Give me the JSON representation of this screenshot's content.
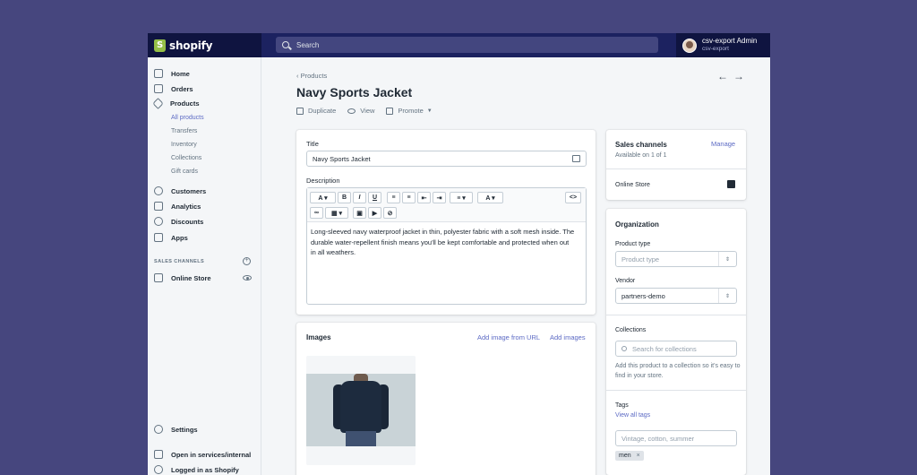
{
  "topbar": {
    "brand": "shopify",
    "search_placeholder": "Search",
    "user_name": "csv-export Admin",
    "user_store": "csv-export"
  },
  "sidebar": {
    "items": [
      {
        "label": "Home",
        "icon": "home-icon"
      },
      {
        "label": "Orders",
        "icon": "orders-icon"
      },
      {
        "label": "Products",
        "icon": "tag-icon"
      },
      {
        "label": "Customers",
        "icon": "customer-icon"
      },
      {
        "label": "Analytics",
        "icon": "analytics-icon"
      },
      {
        "label": "Discounts",
        "icon": "discount-icon"
      },
      {
        "label": "Apps",
        "icon": "apps-icon"
      }
    ],
    "sub_items": [
      "All products",
      "Transfers",
      "Inventory",
      "Collections",
      "Gift cards"
    ],
    "sales_channels_label": "SALES CHANNELS",
    "online_store": "Online Store",
    "settings": "Settings",
    "open_in_services": "Open in services/internal",
    "logged_in": "Logged in as Shopify"
  },
  "main": {
    "breadcrumb": "Products",
    "title": "Navy Sports Jacket",
    "actions": [
      "Duplicate",
      "View",
      "Promote"
    ]
  },
  "product_card": {
    "title_label": "Title",
    "title_value": "Navy Sports Jacket",
    "description_label": "Description",
    "description_text": "Long-sleeved navy waterproof jacket in thin, polyester fabric with a soft mesh inside. The durable water-repellent finish means you'll be kept comfortable and protected when out in all weathers."
  },
  "images_card": {
    "title": "Images",
    "add_from_url": "Add image from URL",
    "add_images": "Add images"
  },
  "sales_channels_card": {
    "title": "Sales channels",
    "subtitle": "Available on 1 of 1",
    "manage": "Manage",
    "channel": "Online Store"
  },
  "organization_card": {
    "title": "Organization",
    "product_type_label": "Product type",
    "product_type_placeholder": "Product type",
    "vendor_label": "Vendor",
    "vendor_value": "partners-demo",
    "collections_label": "Collections",
    "collections_placeholder": "Search for collections",
    "collections_help": "Add this product to a collection so it's easy to find in your store.",
    "tags_label": "Tags",
    "view_all_tags": "View all tags",
    "tags_placeholder": "Vintage, cotton, summer",
    "tag_chip": "men",
    "tag_remove": "×"
  },
  "colors": {
    "background": "#46467e",
    "topbar": "#1c2260",
    "accent": "#5c6ac4",
    "brand_green": "#95bf47"
  }
}
